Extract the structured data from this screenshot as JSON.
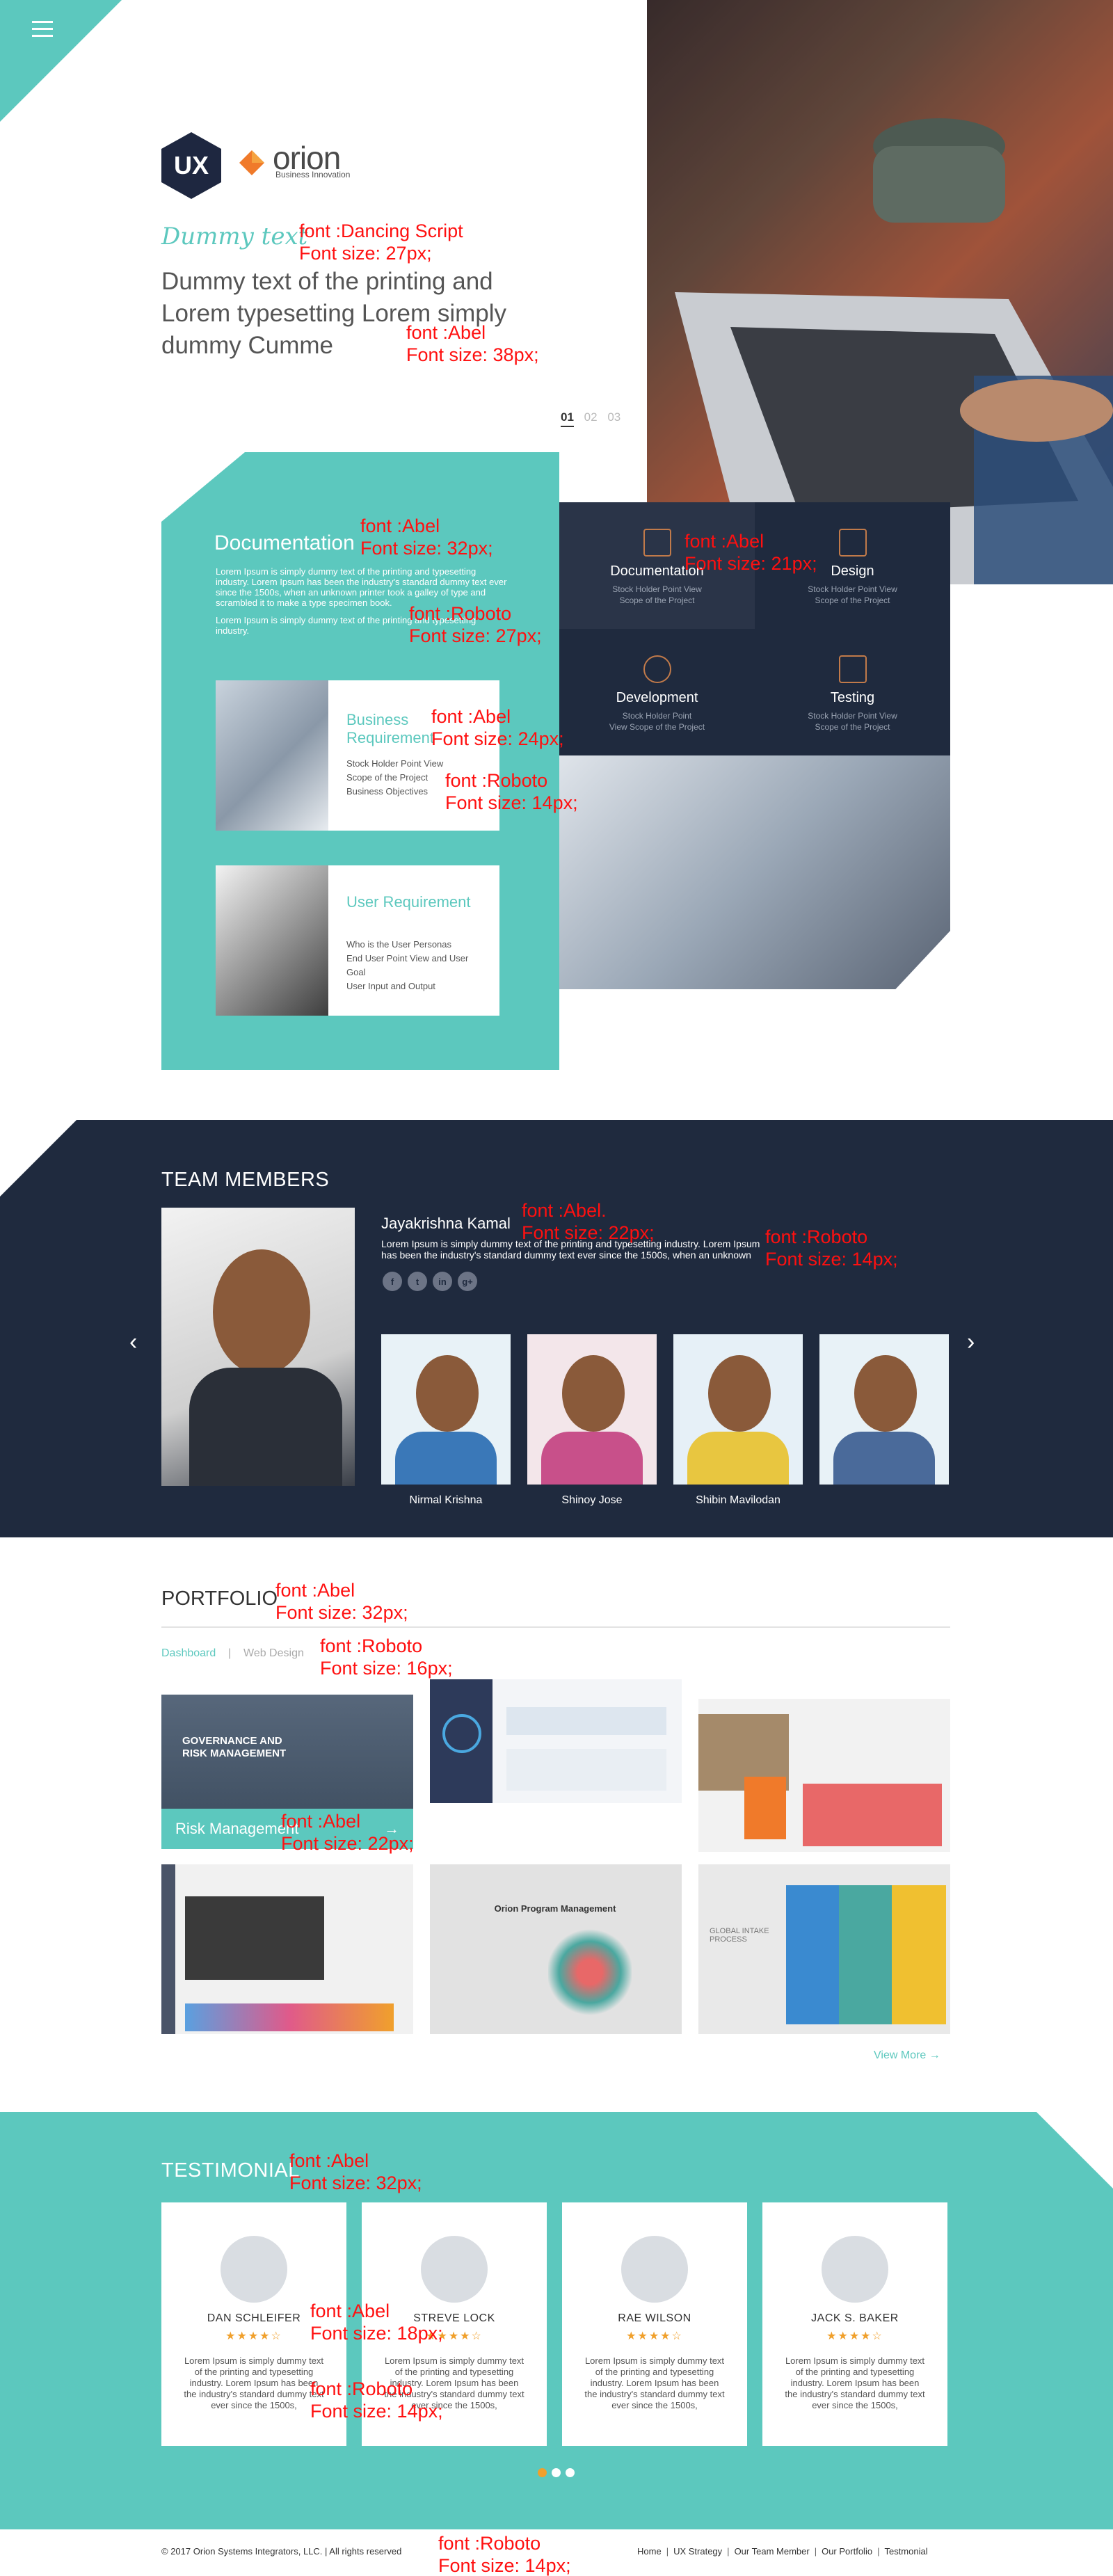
{
  "hero": {
    "logo_mark": "UX",
    "logo_text": "orion",
    "logo_subtext": "Business Innovation",
    "script_text": "Dummy text",
    "title": "Dummy text of the printing and Lorem typesetting Lorem simply dummy Cumme",
    "slides": [
      "01",
      "02",
      "03"
    ]
  },
  "annotations": [
    "font :Dancing Script\nFont size: 27px;",
    "font :Abel\nFont size: 38px;",
    "font :Abel\nFont size: 32px;",
    "font :Abel\nFont size: 21px;",
    "font :Roboto\nFont size: 27px;",
    "font :Abel\nFont size: 24px;",
    "font :Roboto\nFont size: 14px;",
    "font :Abel.\nFont size: 22px;",
    "font :Roboto\nFont size: 14px;",
    "font :Abel\nFont size: 32px;",
    "font :Roboto\nFont size: 16px;",
    "font :Abel\nFont size: 22px;",
    "font :Abel\nFont size: 32px;",
    "font :Abel\nFont size: 18px;",
    "font :Roboto\nFont size: 14px;",
    "font :Roboto\nFont size: 14px;"
  ],
  "documentation": {
    "title": "Documentation",
    "body1": "Lorem Ipsum is simply dummy text of the printing and typesetting industry. Lorem Ipsum has been the industry's standard dummy text ever since the 1500s, when an unknown printer took a galley of type and scrambled it to make a type specimen book.",
    "body2": "Lorem Ipsum is simply dummy text of the printing and typesetting industry."
  },
  "cards": [
    {
      "title": "Business Requirement",
      "items": [
        "Stock Holder Point View",
        "Scope of the Project",
        "Business Objectives"
      ]
    },
    {
      "title": "User Requirement",
      "items": [
        "Who is the User Personas",
        "End User Point View and User Goal",
        "User Input and Output"
      ]
    }
  ],
  "services": [
    {
      "title": "Documentation",
      "sub": "Stock Holder Point View\nScope of the Project",
      "icon": "document-icon"
    },
    {
      "title": "Design",
      "sub": "Stock Holder Point View\nScope of the Project",
      "icon": "design-tools-icon"
    },
    {
      "title": "Development",
      "sub": "Stock Holder Point\nView Scope of the Project",
      "icon": "gear-icon"
    },
    {
      "title": "Testing",
      "sub": "Stock Holder Point View\nScope of the Project",
      "icon": "checklist-icon"
    }
  ],
  "team": {
    "title": "TEAM MEMBERS",
    "lead_name": "Jayakrishna Kamal",
    "lead_bio": "Lorem Ipsum is simply dummy text of the printing and typesetting industry. Lorem Ipsum has been the industry's standard dummy text ever since the 1500s, when an unknown",
    "social": [
      "f",
      "t",
      "in",
      "g+"
    ],
    "members": [
      "Nirmal Krishna",
      "Shinoy Jose",
      "Shibin Mavilodan",
      ""
    ]
  },
  "portfolio": {
    "title": "PORTFOLIO",
    "tabs": [
      "Dashboard",
      "Web Design"
    ],
    "tab_sep": "|",
    "tile1_title": "GOVERNANCE AND RISK MANAGEMENT",
    "tile1_caption": "Risk Management",
    "tile5_title": "Orion Program Management",
    "tile6_text": "GLOBAL INTAKE PROCESS",
    "view_more": "View More"
  },
  "testimonial": {
    "title": "TESTIMONIAL",
    "people": [
      {
        "name": "DAN SCHLEIFER",
        "stars": "★★★★☆"
      },
      {
        "name": "STREVE LOCK",
        "stars": "★★★★☆"
      },
      {
        "name": "RAE WILSON",
        "stars": "★★★★☆"
      },
      {
        "name": "JACK S. BAKER",
        "stars": "★★★★☆"
      }
    ],
    "quote": "Lorem Ipsum is simply dummy text of the printing and typesetting industry. Lorem Ipsum has been the industry's standard dummy text ever since the 1500s,"
  },
  "footer": {
    "copyright": "© 2017 Orion Systems Integrators, LLC. | All rights reserved",
    "links": [
      "Home",
      "UX Strategy",
      "Our Team Member",
      "Our Portfolio",
      "Testmonial"
    ],
    "sep": "|"
  },
  "colors": {
    "teal": "#5cc8be",
    "navy": "#1f2a3e",
    "orange": "#f0a02c",
    "annotation": "#ff1010"
  }
}
